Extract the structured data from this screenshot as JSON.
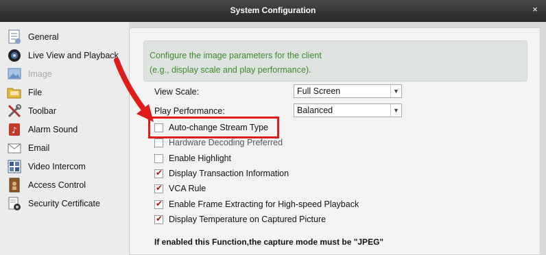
{
  "window": {
    "title": "System Configuration",
    "close_glyph": "×"
  },
  "sidebar": {
    "items": [
      {
        "label": "General",
        "icon": "general-icon"
      },
      {
        "label": "Live View and Playback",
        "icon": "camera-icon"
      },
      {
        "label": "Image",
        "icon": "image-icon"
      },
      {
        "label": "File",
        "icon": "folder-icon"
      },
      {
        "label": "Toolbar",
        "icon": "tools-icon"
      },
      {
        "label": "Alarm Sound",
        "icon": "alarm-sound-icon"
      },
      {
        "label": "Email",
        "icon": "email-icon"
      },
      {
        "label": "Video Intercom",
        "icon": "intercom-icon"
      },
      {
        "label": "Access Control",
        "icon": "access-control-icon"
      },
      {
        "label": "Security Certificate",
        "icon": "certificate-icon"
      }
    ]
  },
  "main": {
    "info_line1": "Configure the image parameters for the client",
    "info_line2": "(e.g., display scale and play performance).",
    "view_scale": {
      "label": "View Scale:",
      "value": "Full Screen"
    },
    "play_performance": {
      "label": "Play Performance:",
      "value": "Balanced"
    },
    "checks": [
      {
        "label": "Auto-change Stream Type",
        "checked": false
      },
      {
        "label": "Hardware Decoding Preferred",
        "checked": false
      },
      {
        "label": "Enable Highlight",
        "checked": false
      },
      {
        "label": "Display Transaction Information",
        "checked": true
      },
      {
        "label": "VCA Rule",
        "checked": true
      },
      {
        "label": "Enable Frame Extracting for High-speed Playback",
        "checked": true
      },
      {
        "label": "Display Temperature on Captured Picture",
        "checked": true
      }
    ],
    "hint": "If enabled this Function,the capture mode must be \"JPEG\""
  },
  "colors": {
    "annotation_red": "#e01b1b",
    "info_text": "#3c8a2e",
    "check_mark": "#b01010"
  }
}
